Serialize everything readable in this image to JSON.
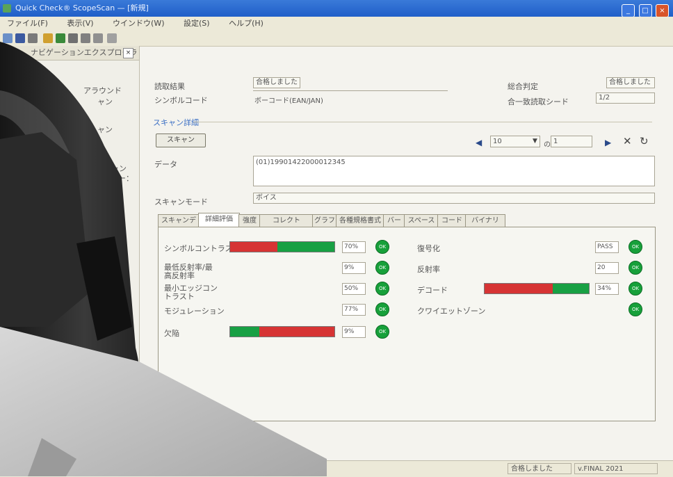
{
  "window": {
    "title": "Quick Check® ScopeScan — [新規]"
  },
  "menu": [
    "ファイル(F)",
    "表示(V)",
    "ウインドウ(W)",
    "設定(S)",
    "ヘルプ(H)"
  ],
  "sidebar": {
    "header": "ナビゲーションエクスプローラ",
    "close": "×",
    "items": [
      "アラウンド",
      "ャン",
      "ャン",
      "ャン",
      "ー："
    ]
  },
  "main": {
    "fields": {
      "status_label": "読取結果",
      "status_value": "合格しました",
      "symbology_label": "シンボルコード",
      "symbology_value": "ボーコード(EAN/JAN)",
      "overall_label": "総合判定",
      "overall_value": "合格しました",
      "pass_label": "合一致読取シード",
      "pass_value": "1/2",
      "scan_link": "スキャン詳細",
      "scan_button": "スキャン",
      "data_label": "データ",
      "data_value": "(01)19901422000012345",
      "scan_mode_label": "スキャンモード",
      "scan_mode_value": "ボイス"
    },
    "nav": {
      "count": "10",
      "of_label": "の",
      "total": "1"
    },
    "tabs": [
      "スキャンデータ",
      "詳細評価",
      "強度",
      "コレクト",
      "グラフ",
      "各種規格書式",
      "バー",
      "スペース",
      "コード",
      "バイナリ"
    ],
    "left_metrics": [
      {
        "label": "シンボルコントラスト",
        "value": "70%",
        "status": "OK",
        "bar": [
          {
            "color": "#d63434",
            "pct": 0.45
          },
          {
            "color": "#18a044",
            "pct": 0.55
          }
        ]
      },
      {
        "label": "最低反射率/最高反射率",
        "value": "9%",
        "status": "OK"
      },
      {
        "label": "最小エッジコントラスト",
        "value": "50%",
        "status": "OK"
      },
      {
        "label": "モジュレーション",
        "value": "77%",
        "status": "OK"
      },
      {
        "label": "欠陥",
        "value": "9%",
        "status": "OK",
        "bar": [
          {
            "color": "#18a044",
            "pct": 0.28
          },
          {
            "color": "#d63434",
            "pct": 0.72
          }
        ]
      }
    ],
    "right_metrics": [
      {
        "label": "復号化",
        "value": "PASS",
        "status": "OK"
      },
      {
        "label": "反射率",
        "value": "20",
        "status": "OK"
      },
      {
        "label": "デコード",
        "value": "34%",
        "status": "OK",
        "bar": [
          {
            "color": "#d63434",
            "pct": 0.65
          },
          {
            "color": "#18a044",
            "pct": 0.35
          }
        ]
      },
      {
        "label": "クワイエットゾーン",
        "value": "",
        "status": "OK"
      }
    ]
  },
  "status": {
    "message": "合格しました",
    "version": "v.FINAL 2021"
  },
  "colors": {
    "accent": "#1f5ec8",
    "ok_green": "#17a03a",
    "fail_red": "#d63434"
  }
}
